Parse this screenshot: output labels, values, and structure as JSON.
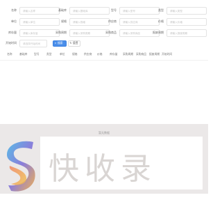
{
  "filters": [
    {
      "label": "名称",
      "placeholder": "请输入名称"
    },
    {
      "label": "基础库",
      "placeholder": "请输入基础库"
    },
    {
      "label": "型号",
      "placeholder": "请输入型号"
    },
    {
      "label": "类型",
      "placeholder": "请输入类型"
    },
    {
      "label": "单位",
      "placeholder": "请输入单位"
    },
    {
      "label": "规格",
      "placeholder": "请输入规格"
    },
    {
      "label": "供应商",
      "placeholder": "请输入供应商"
    },
    {
      "label": "价格",
      "placeholder": "请输入价格"
    },
    {
      "label": "库存量",
      "placeholder": "请输入库存量"
    },
    {
      "label": "采购周期",
      "placeholder": "请输入采购周期"
    },
    {
      "label": "采购商品",
      "placeholder": "请输入采购商品"
    },
    {
      "label": "报废周期",
      "placeholder": "请输入报废周期"
    },
    {
      "label": "开始时间",
      "placeholder": "请选择开始时间"
    }
  ],
  "buttons": {
    "search_label": "搜索",
    "reset_label": "重置"
  },
  "icons": {
    "search": "search-icon",
    "reset": "refresh-icon"
  },
  "table": {
    "columns": [
      "名称",
      "基础库",
      "型号",
      "类型",
      "单位",
      "规格",
      "供应商",
      "价格",
      "库存量",
      "采购周期",
      "采购商品",
      "报废周期",
      "开始时间"
    ],
    "empty_text": "暂无数据"
  },
  "watermark": {
    "text": "快收录"
  },
  "colors": {
    "primary": "#4a8eea",
    "border": "#e3e3e3",
    "watermark_band": "#ddd9d8"
  }
}
